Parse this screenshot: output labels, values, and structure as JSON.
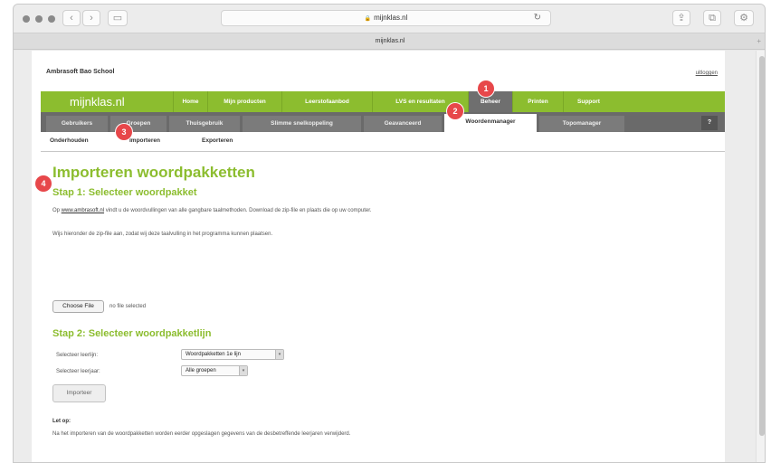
{
  "browser": {
    "url": "mijnklas.nl",
    "tab_title": "mijnklas.nl",
    "back_glyph": "‹",
    "forward_glyph": "›",
    "sidebar_glyph": "▭",
    "reload_glyph": "↻",
    "share_glyph": "⇪",
    "tabs_glyph": "⧉",
    "settings_glyph": "⚙",
    "newtab_glyph": "+",
    "lock_glyph": "🔒"
  },
  "page": {
    "school_name": "Ambrasoft Bao School",
    "logout": "uitloggen",
    "brand": "mijnklas.nl",
    "main_nav": [
      "Home",
      "Mijn producten",
      "Leerstofaanbod",
      "LVS en resultaten",
      "Beheer",
      "Printen",
      "Support"
    ],
    "main_nav_active": "Beheer",
    "sub_nav": [
      "Gebruikers",
      "Groepen",
      "Thuisgebruik",
      "Slimme snelkoppeling",
      "Geavanceerd",
      "Woordenmanager",
      "Topomanager"
    ],
    "sub_nav_active": "Woordenmanager",
    "help_label": "?",
    "tert_nav": [
      "Onderhouden",
      "Importeren",
      "Exporteren"
    ],
    "title": "Importeren woordpakketten",
    "step1_title": "Stap 1: Selecteer woordpakket",
    "step1_text_pre": "Op ",
    "step1_link": "www.ambrasoft.nl",
    "step1_text_post": " vindt u de woordvullingen van alle gangbare taalmethoden. Download de zip-file en plaats die op uw computer.",
    "step1_text2": "Wijs hieronder de zip-file aan, zodat wij deze taalvulling in het programma kunnen plaatsen.",
    "choose_file": "Choose File",
    "no_file": "no file selected",
    "step2_title": "Stap 2: Selecteer woordpakketlijn",
    "select_leerlijn_label": "Selecteer leerlijn:",
    "select_leerlijn_value": "Woordpakketten 1e lijn",
    "select_leerjaar_label": "Selecteer leerjaar:",
    "select_leerjaar_value": "Alle groepen",
    "select_arrow_glyph": "▾",
    "import_button": "Importeer",
    "note_title": "Let op:",
    "note_text": "Na het importeren van de woordpakketten worden eerder opgeslagen gegevens van de desbetreffende leerjaren verwijderd."
  },
  "badges": [
    "1",
    "2",
    "3",
    "4"
  ],
  "colors": {
    "brand_green": "#8cbd2f",
    "badge_red": "#e7474a",
    "subnav_gray": "#6a6a6a"
  }
}
